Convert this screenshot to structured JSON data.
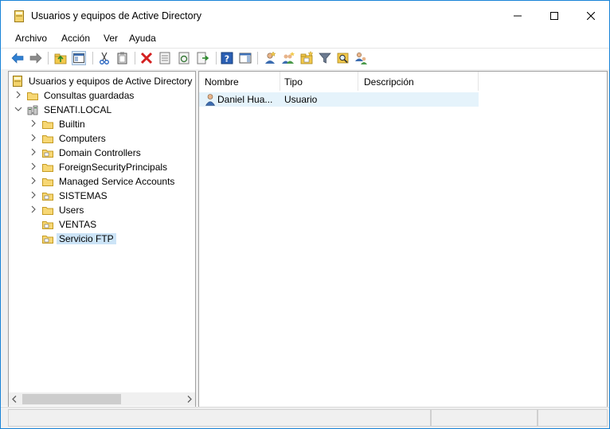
{
  "window": {
    "title": "Usuarios y equipos de Active Directory",
    "accent": "#1883d7"
  },
  "menu": {
    "items": [
      {
        "label": "Archivo"
      },
      {
        "label": "Acción"
      },
      {
        "label": "Ver"
      },
      {
        "label": "Ayuda"
      }
    ]
  },
  "toolbar": {
    "buttons": [
      {
        "icon": "back-arrow-icon"
      },
      {
        "icon": "forward-arrow-icon"
      },
      {
        "icon": "up-folder-icon"
      },
      {
        "icon": "show-hide-console-tree-icon"
      },
      {
        "icon": "cut-icon"
      },
      {
        "icon": "paste-icon"
      },
      {
        "icon": "delete-icon"
      },
      {
        "icon": "properties-icon"
      },
      {
        "icon": "refresh-icon"
      },
      {
        "icon": "export-list-icon"
      },
      {
        "icon": "help-icon"
      },
      {
        "icon": "action-pane-icon"
      },
      {
        "icon": "new-user-icon"
      },
      {
        "icon": "new-group-icon"
      },
      {
        "icon": "new-ou-icon"
      },
      {
        "icon": "filter-icon"
      },
      {
        "icon": "find-icon"
      },
      {
        "icon": "add-to-group-icon"
      }
    ]
  },
  "tree": {
    "root": {
      "label": "Usuarios y equipos de Active Directory ["
    },
    "saved_queries": {
      "label": "Consultas guardadas"
    },
    "domain": {
      "label": "SENATI.LOCAL"
    },
    "children": [
      {
        "label": "Builtin",
        "type": "container"
      },
      {
        "label": "Computers",
        "type": "container"
      },
      {
        "label": "Domain Controllers",
        "type": "ou"
      },
      {
        "label": "ForeignSecurityPrincipals",
        "type": "container"
      },
      {
        "label": "Managed Service Accounts",
        "type": "container"
      },
      {
        "label": "SISTEMAS",
        "type": "ou"
      },
      {
        "label": "Users",
        "type": "container"
      },
      {
        "label": "VENTAS",
        "type": "ou"
      },
      {
        "label": "Servicio FTP",
        "type": "ou"
      }
    ]
  },
  "list": {
    "columns": [
      "Nombre",
      "Tipo",
      "Descripción"
    ],
    "rows": [
      {
        "name": "Daniel Hua...",
        "type": "Usuario",
        "description": ""
      }
    ]
  }
}
